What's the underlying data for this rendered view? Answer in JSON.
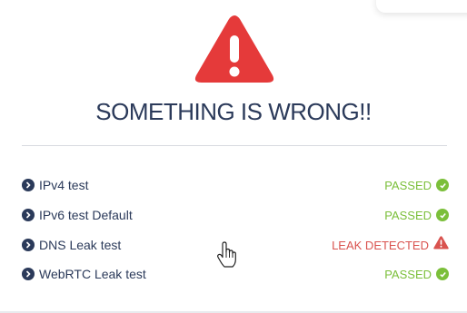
{
  "header": {
    "title": "SOMETHING IS WRONG!!",
    "icon": "warning-triangle-icon"
  },
  "tests": [
    {
      "label": "IPv4 test",
      "status": "PASSED",
      "state": "passed"
    },
    {
      "label": "IPv6 test Default",
      "status": "PASSED",
      "state": "passed"
    },
    {
      "label": "DNS Leak test",
      "status": "LEAK DETECTED",
      "state": "leak"
    },
    {
      "label": "WebRTC Leak test",
      "status": "PASSED",
      "state": "passed"
    }
  ],
  "colors": {
    "title": "#2b3a5a",
    "warning": "#e53a3a",
    "passed": "#7bbf3a",
    "leak": "#d9534f"
  }
}
